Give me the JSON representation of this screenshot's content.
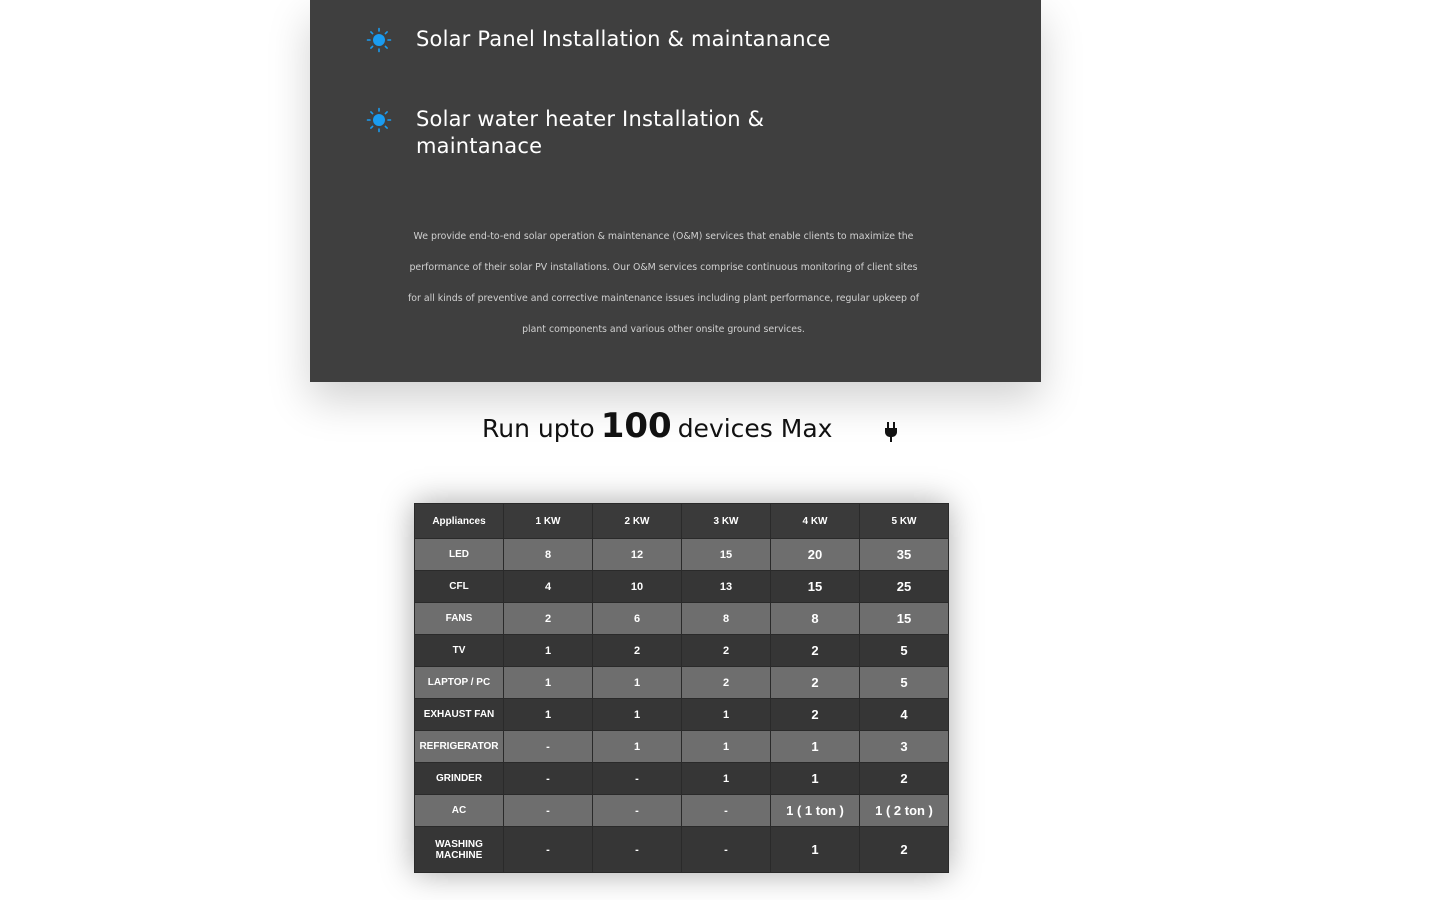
{
  "services": [
    {
      "title": "Solar Panel Installation & maintanance",
      "icon": "sun-icon"
    },
    {
      "title": "Solar water heater Installation & maintanace",
      "icon": "sun-icon"
    }
  ],
  "description": "We provide end-to-end solar operation & maintenance (O&M) services that enable clients to maximize the performance of their solar PV installations. Our O&M services comprise continuous monitoring of client sites for all kinds of preventive and corrective maintenance issues including plant performance, regular upkeep of plant components and various other onsite ground services.",
  "headline": {
    "prefix": "Run upto",
    "number": "100",
    "suffix": "devices Max",
    "icon": "plug-icon"
  },
  "colors": {
    "panel": "#3f3f3f",
    "accent": "#1a9cf0",
    "row_dark": "#363636",
    "row_light": "#6e6e6e"
  },
  "table": {
    "headers": [
      "Appliances",
      "1 KW",
      "2 KW",
      "3 KW",
      "4 KW",
      "5 KW"
    ],
    "rows": [
      [
        "LED",
        "8",
        "12",
        "15",
        "20",
        "35"
      ],
      [
        "CFL",
        "4",
        "10",
        "13",
        "15",
        "25"
      ],
      [
        "FANS",
        "2",
        "6",
        "8",
        "8",
        "15"
      ],
      [
        "TV",
        "1",
        "2",
        "2",
        "2",
        "5"
      ],
      [
        "LAPTOP / PC",
        "1",
        "1",
        "2",
        "2",
        "5"
      ],
      [
        "EXHAUST FAN",
        "1",
        "1",
        "1",
        "2",
        "4"
      ],
      [
        "REFRIGERATOR",
        "-",
        "1",
        "1",
        "1",
        "3"
      ],
      [
        "GRINDER",
        "-",
        "-",
        "1",
        "1",
        "2"
      ],
      [
        "AC",
        "-",
        "-",
        "-",
        "1 ( 1 ton )",
        "1 ( 2 ton )"
      ],
      [
        "WASHING MACHINE",
        "-",
        "-",
        "-",
        "1",
        "2"
      ]
    ]
  }
}
